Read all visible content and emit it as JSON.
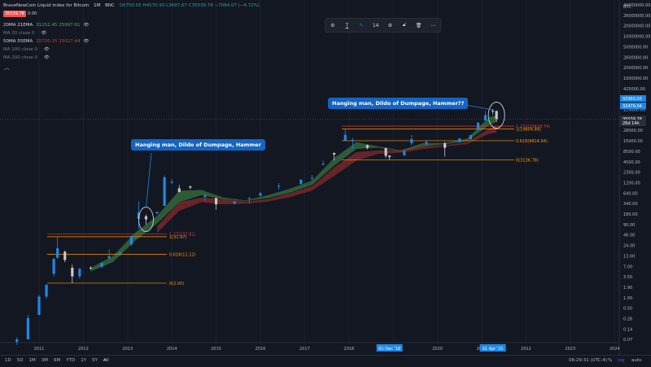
{
  "header": {
    "title": "BraveNewCoin Liquid Index for Bitcoin",
    "interval": "1M",
    "exchange": "BNC",
    "ohlc": "O5750.05 H4570.93 L3697.67 C35539.78 −7064.07 (−4.72%)",
    "price_badge": "35539.78",
    "change_badge": "0.00"
  },
  "indicators": [
    {
      "name": "20MA 21EMA",
      "values": "31152.45  25997.61",
      "color": "#4caf50"
    },
    {
      "name": "MA 20 close 0",
      "values": "",
      "color": "#787b86"
    },
    {
      "name": "50MA 55EMA",
      "values": "15720.15  15027.44",
      "color": "#e53935"
    },
    {
      "name": "MA 100 close 0",
      "values": "",
      "color": "#787b86"
    },
    {
      "name": "MA 200 close 0",
      "values": "",
      "color": "#787b86"
    }
  ],
  "toolbar": {
    "font_size": "14"
  },
  "annotations": [
    {
      "text": "Hanging man, Dildo of Dumpage, Hammer"
    },
    {
      "text": "Hanging man, Dildo of Dumpage, Hammer??"
    }
  ],
  "fib_left": [
    {
      "label": "1.272(37.81)",
      "color": "#e53935"
    },
    {
      "label": "1(31.97)",
      "color": "#ff9800"
    },
    {
      "label": "0.618(11.12)",
      "color": "#ff9800"
    },
    {
      "label": "0(2.00)",
      "color": "#ff9800"
    }
  ],
  "fib_right": [
    {
      "label": "1.272(23418.74)",
      "color": "#e53935"
    },
    {
      "label": "1(19804.89)",
      "color": "#ff9800"
    },
    {
      "label": "0.618(9814.64)",
      "color": "#ff9800"
    },
    {
      "label": "0(3136.78)",
      "color": "#ff9800"
    }
  ],
  "price_tags": [
    {
      "label": "92993.03",
      "bg": "#1e88e5"
    },
    {
      "label": "32479.04",
      "bg": "#1e88e5"
    },
    {
      "label": "35539.78",
      "bg": "#2a2e39"
    },
    {
      "label": "26d 14h",
      "bg": "#2a2e39"
    }
  ],
  "date_tags": [
    "01 Dec '18",
    "01 Apr '21"
  ],
  "bottom": {
    "ranges": [
      "1D",
      "5D",
      "1M",
      "3M",
      "6M",
      "YTD",
      "1Y",
      "5Y",
      "All"
    ],
    "clock": "06:29:31 (UTC-4)",
    "opts": [
      "%",
      "log",
      "auto"
    ]
  },
  "chart_data": {
    "type": "candlestick",
    "title": "BraveNewCoin Liquid Index for Bitcoin",
    "interval": "1M",
    "y_scale": "log",
    "y_axis_currency": "BTC",
    "y_ticks": [
      "40000000.00",
      "26000000.00",
      "20000000.00",
      "10000000.00",
      "5000000.00",
      "2600000.00",
      "2000000.00",
      "1000000.00",
      "425000.00",
      "225000.00",
      "114000.00",
      "59000.00",
      "28000.00",
      "15000.00",
      "8500.00",
      "4500.00",
      "2300.00",
      "1200.00",
      "640.00",
      "340.00",
      "180.00",
      "90.00",
      "46.00",
      "24.00",
      "13.00",
      "7.00",
      "3.50",
      "1.90",
      "1.00",
      "0.50",
      "0.26",
      "0.14",
      "0.07"
    ],
    "x_ticks": [
      "2011",
      "2012",
      "2013",
      "2014",
      "2015",
      "2016",
      "2017",
      "2018",
      "2019",
      "2020",
      "2021",
      "2022",
      "2023",
      "2024"
    ],
    "candles_approx": [
      [
        "2010-07",
        0.06,
        0.08,
        0.05,
        0.07
      ],
      [
        "2010-10",
        0.07,
        0.3,
        0.07,
        0.25
      ],
      [
        "2011-01",
        0.3,
        1.0,
        0.3,
        0.9
      ],
      [
        "2011-03",
        0.9,
        1.9,
        0.8,
        1.8
      ],
      [
        "2011-05",
        3.5,
        9,
        3,
        8.5
      ],
      [
        "2011-06",
        9,
        32,
        10,
        16
      ],
      [
        "2011-08",
        13,
        14,
        7,
        8
      ],
      [
        "2011-10",
        5,
        6,
        2,
        3
      ],
      [
        "2011-12",
        3,
        5,
        2.6,
        4.7
      ],
      [
        "2012-03",
        5,
        5.5,
        4.5,
        4.9
      ],
      [
        "2012-06",
        5.3,
        7,
        5,
        6.7
      ],
      [
        "2012-08",
        9,
        15,
        8,
        10
      ],
      [
        "2012-11",
        11,
        13,
        10,
        12.5
      ],
      [
        "2013-02",
        20,
        35,
        19,
        33
      ],
      [
        "2013-04",
        93,
        266,
        50,
        135
      ],
      [
        "2013-06",
        108,
        120,
        65,
        90
      ],
      [
        "2013-09",
        130,
        145,
        120,
        140
      ],
      [
        "2013-11",
        200,
        1240,
        200,
        1100
      ],
      [
        "2014-01",
        800,
        1000,
        760,
        850
      ],
      [
        "2014-03",
        570,
        700,
        450,
        460
      ],
      [
        "2014-06",
        640,
        680,
        540,
        600
      ],
      [
        "2014-10",
        340,
        420,
        275,
        370
      ],
      [
        "2015-01",
        320,
        330,
        160,
        220
      ],
      [
        "2015-06",
        230,
        270,
        220,
        260
      ],
      [
        "2015-10",
        310,
        340,
        230,
        320
      ],
      [
        "2016-01",
        370,
        460,
        350,
        430
      ],
      [
        "2016-06",
        670,
        780,
        530,
        670
      ],
      [
        "2016-12",
        740,
        980,
        730,
        960
      ],
      [
        "2017-03",
        1050,
        1280,
        900,
        1080
      ],
      [
        "2017-06",
        2400,
        3000,
        2200,
        2500
      ],
      [
        "2017-09",
        4700,
        4900,
        3000,
        4300
      ],
      [
        "2017-12",
        10000,
        19800,
        10000,
        14000
      ],
      [
        "2018-02",
        10200,
        11700,
        6000,
        10300
      ],
      [
        "2018-06",
        7500,
        7800,
        5800,
        6400
      ],
      [
        "2018-11",
        6300,
        6500,
        3500,
        4000
      ],
      [
        "2018-12",
        4000,
        4200,
        3136,
        3700
      ],
      [
        "2019-04",
        4100,
        5600,
        4100,
        5300
      ],
      [
        "2019-06",
        8500,
        13800,
        7500,
        10800
      ],
      [
        "2019-10",
        8300,
        10300,
        7300,
        9100
      ],
      [
        "2020-03",
        8500,
        9100,
        3800,
        6400
      ],
      [
        "2020-07",
        9100,
        11400,
        9000,
        11300
      ],
      [
        "2020-10",
        10800,
        14000,
        10400,
        13800
      ],
      [
        "2020-12",
        19600,
        29300,
        17600,
        29000
      ],
      [
        "2021-02",
        33000,
        58300,
        32300,
        45000
      ],
      [
        "2021-04",
        58700,
        64800,
        47000,
        57700
      ],
      [
        "2021-05",
        57700,
        59500,
        30000,
        35539.78
      ]
    ],
    "fib_left_levels": [
      37.81,
      31.97,
      11.12,
      2.0
    ],
    "fib_right_levels": [
      23418.74,
      19804.89,
      9814.64,
      3136.78
    ]
  }
}
